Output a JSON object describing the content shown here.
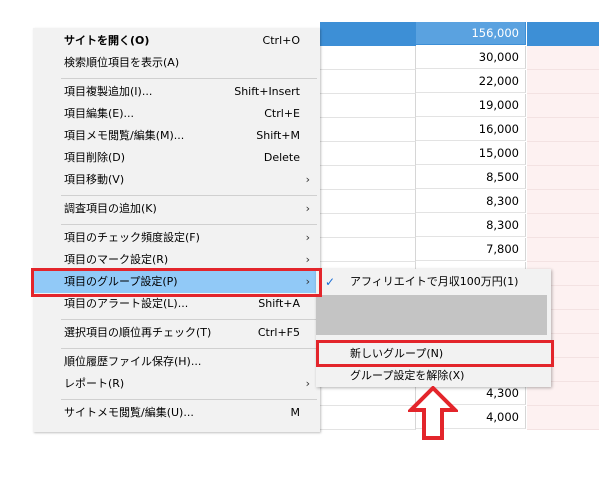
{
  "table": {
    "values": [
      "156,000",
      "30,000",
      "22,000",
      "19,000",
      "16,000",
      "15,000",
      "8,500",
      "8,300",
      "8,300",
      "7,800",
      "",
      "",
      "",
      "",
      "",
      "",
      "",
      "",
      "4,300",
      "4,000"
    ]
  },
  "menu": {
    "items": [
      {
        "label": "サイトを開く(O)",
        "shortcut": "Ctrl+O",
        "arrow": ""
      },
      {
        "label": "検索順位項目を表示(A)",
        "shortcut": "",
        "arrow": ""
      },
      {
        "label": "項目複製追加(I)...",
        "shortcut": "Shift+Insert",
        "arrow": ""
      },
      {
        "label": "項目編集(E)...",
        "shortcut": "Ctrl+E",
        "arrow": ""
      },
      {
        "label": "項目メモ閲覧/編集(M)...",
        "shortcut": "Shift+M",
        "arrow": ""
      },
      {
        "label": "項目削除(D)",
        "shortcut": "Delete",
        "arrow": ""
      },
      {
        "label": "項目移動(V)",
        "shortcut": "",
        "arrow": "›"
      },
      {
        "label": "調査項目の追加(K)",
        "shortcut": "",
        "arrow": "›"
      },
      {
        "label": "項目のチェック頻度設定(F)",
        "shortcut": "",
        "arrow": "›"
      },
      {
        "label": "項目のマーク設定(R)",
        "shortcut": "",
        "arrow": "›"
      },
      {
        "label": "項目のグループ設定(P)",
        "shortcut": "",
        "arrow": "›"
      },
      {
        "label": "項目のアラート設定(L)...",
        "shortcut": "Shift+A",
        "arrow": ""
      },
      {
        "label": "選択項目の順位再チェック(T)",
        "shortcut": "Ctrl+F5",
        "arrow": ""
      },
      {
        "label": "順位履歴ファイル保存(H)...",
        "shortcut": "",
        "arrow": ""
      },
      {
        "label": "レポート(R)",
        "shortcut": "",
        "arrow": "›"
      },
      {
        "label": "サイトメモ閲覧/編集(U)...",
        "shortcut": "M",
        "arrow": ""
      }
    ]
  },
  "submenu": {
    "check_mark": "✓",
    "items": [
      {
        "label": "アフィリエイトで月収100万円(1)"
      },
      {
        "label": "新しいグループ(N)"
      },
      {
        "label": "グループ設定を解除(X)"
      }
    ]
  },
  "colors": {
    "highlight": "#91c9f7",
    "annotation": "#e3252b",
    "selected_row": "#3d8fd6"
  }
}
